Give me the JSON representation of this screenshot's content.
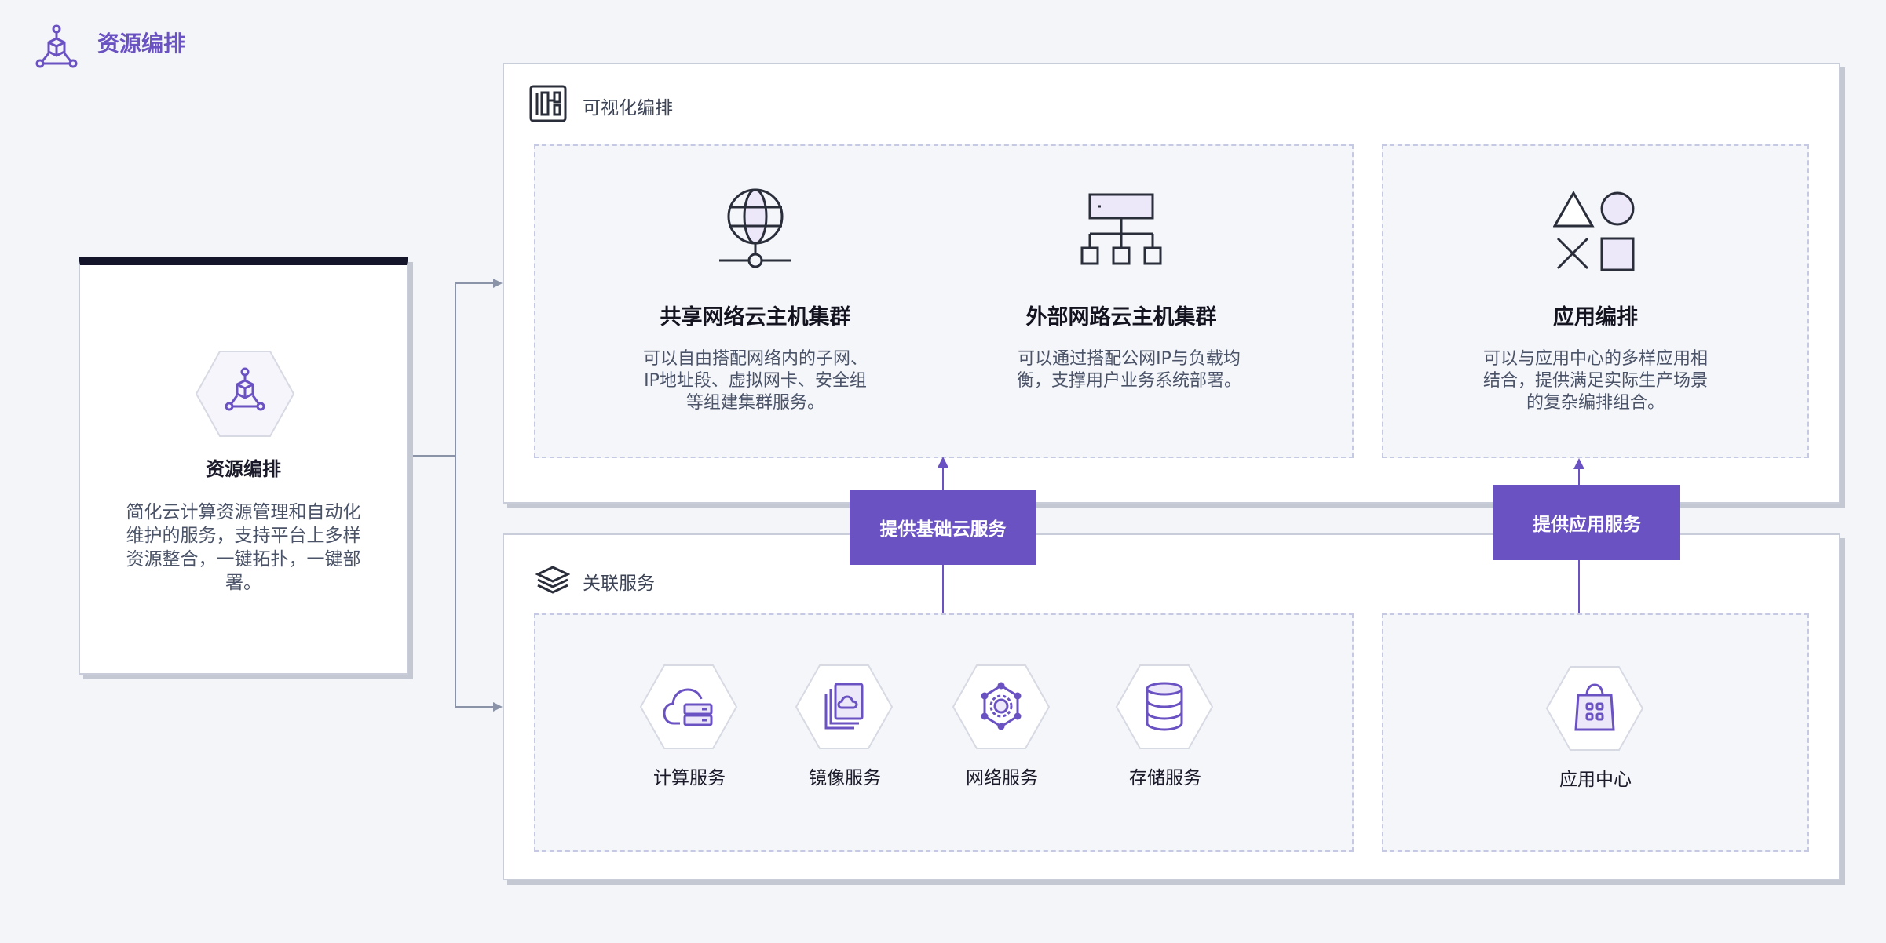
{
  "header": {
    "title": "资源编排",
    "icon": "cube-network-icon"
  },
  "left_card": {
    "title": "资源编排",
    "description": "简化云计算资源管理和自动化维护的服务，支持平台上多样资源整合，一键拓扑，一键部署。",
    "icon": "cube-network-icon"
  },
  "visual_panel": {
    "label": "可视化编排",
    "icon": "layout-icon",
    "features": [
      {
        "title": "共享网络云主机集群",
        "description": "可以自由搭配网络内的子网、IP地址段、虚拟网卡、安全组等组建集群服务。",
        "icon": "globe-network-icon"
      },
      {
        "title": "外部网路云主机集群",
        "description": "可以通过搭配公网IP与负载均衡，支撑用户业务系统部署。",
        "icon": "hierarchy-icon"
      },
      {
        "title": "应用编排",
        "description": "可以与应用中心的多样应用相结合，提供满足实际生产场景的复杂编排组合。",
        "icon": "shapes-icon"
      }
    ]
  },
  "related_panel": {
    "label": "关联服务",
    "icon": "layers-icon",
    "services": [
      {
        "label": "计算服务",
        "icon": "cloud-server-icon"
      },
      {
        "label": "镜像服务",
        "icon": "image-cloud-icon"
      },
      {
        "label": "网络服务",
        "icon": "network-gear-icon"
      },
      {
        "label": "存储服务",
        "icon": "database-icon"
      }
    ],
    "app_center": {
      "label": "应用中心",
      "icon": "shopping-bag-icon"
    }
  },
  "flows": {
    "basic": "提供基础云服务",
    "app": "提供应用服务"
  },
  "colors": {
    "accent": "#6b52c3",
    "text": "#1a1a2a",
    "muted": "#4a5368",
    "border": "#c8cdd9"
  }
}
